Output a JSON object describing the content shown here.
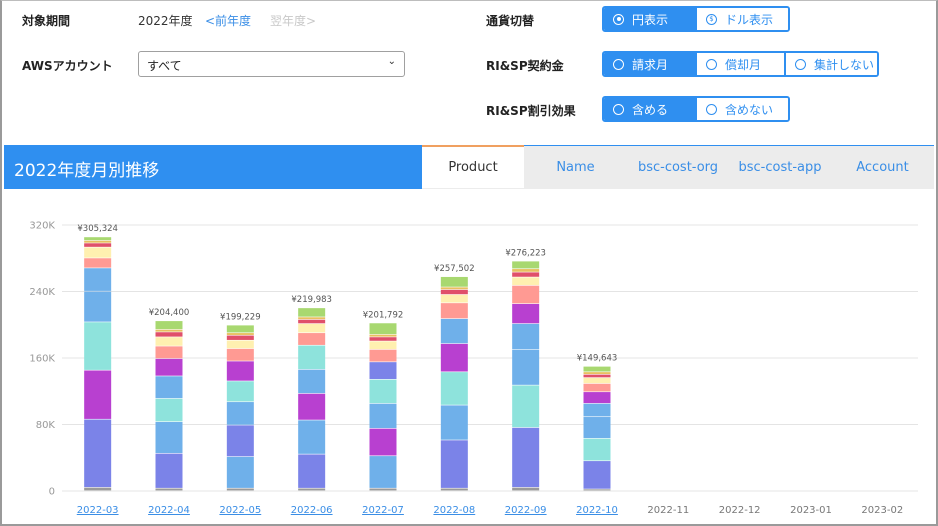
{
  "filters": {
    "period_label": "対象期間",
    "period_value": "2022年度",
    "prev_year": "<前年度",
    "next_year": "翌年度>",
    "account_label": "AWSアカウント",
    "account_value": "すべて",
    "currency_label": "通貨切替",
    "currency_options": [
      "円表示",
      "ドル表示"
    ],
    "currency_selected": "円表示",
    "risp_contract_label": "RI&SP契約金",
    "risp_contract_options": [
      "請求月",
      "償却月",
      "集計しない"
    ],
    "risp_contract_selected": "請求月",
    "risp_discount_label": "RI&SP割引効果",
    "risp_discount_options": [
      "含める",
      "含めない"
    ],
    "risp_discount_selected": "含める"
  },
  "panel": {
    "title": "2022年度月別推移",
    "tabs": [
      "Product",
      "Name",
      "bsc-cost-org",
      "bsc-cost-app",
      "Account"
    ],
    "active_tab": "Product"
  },
  "colors": {
    "accent": "#2f8ff0",
    "segments": [
      "#9a9a9a",
      "#7b83e8",
      "#6fb0ea",
      "#8ee3dc",
      "#b840d0",
      "#ff9a93",
      "#fff0b0",
      "#e0506a",
      "#e8c060",
      "#a8d870"
    ]
  },
  "chart_data": {
    "type": "bar",
    "stacked": true,
    "title": "",
    "xlabel": "",
    "ylabel": "",
    "ylim": [
      0,
      320000
    ],
    "yticks": [
      0,
      80000,
      160000,
      240000,
      320000
    ],
    "ytick_labels": [
      "0",
      "80K",
      "160K",
      "240K",
      "320K"
    ],
    "grid": true,
    "categories": [
      "2022-03",
      "2022-04",
      "2022-05",
      "2022-06",
      "2022-07",
      "2022-08",
      "2022-09",
      "2022-10",
      "2022-11",
      "2022-12",
      "2023-01",
      "2023-02"
    ],
    "linked_categories": [
      "2022-03",
      "2022-04",
      "2022-05",
      "2022-06",
      "2022-07",
      "2022-08",
      "2022-09",
      "2022-10"
    ],
    "totals": [
      305324,
      204400,
      199229,
      219983,
      201792,
      257502,
      276223,
      149643,
      null,
      null,
      null,
      null
    ],
    "total_labels": [
      "¥305,324",
      "¥204,400",
      "¥199,229",
      "¥219,983",
      "¥201,792",
      "¥257,502",
      "¥276,223",
      "¥149,643",
      "",
      "",
      "",
      ""
    ],
    "bars": [
      [
        [
          "#9a9a9a",
          4000
        ],
        [
          "#7b83e8",
          82000
        ],
        [
          "#b840d0",
          59000
        ],
        [
          "#8ee3dc",
          58000
        ],
        [
          "#6fb0ea",
          37000
        ],
        [
          "#6fb0ea",
          28000
        ],
        [
          "#ff9a93",
          12000
        ],
        [
          "#fff0b0",
          13000
        ],
        [
          "#e0506a",
          5000
        ],
        [
          "#e8c060",
          3000
        ],
        [
          "#a8d870",
          4324
        ]
      ],
      [
        [
          "#9a9a9a",
          3000
        ],
        [
          "#7b83e8",
          42000
        ],
        [
          "#6fb0ea",
          38000
        ],
        [
          "#8ee3dc",
          28000
        ],
        [
          "#6fb0ea",
          27000
        ],
        [
          "#b840d0",
          21000
        ],
        [
          "#ff9a93",
          15000
        ],
        [
          "#fff0b0",
          11000
        ],
        [
          "#e0506a",
          6000
        ],
        [
          "#e8c060",
          3000
        ],
        [
          "#a8d870",
          10400
        ]
      ],
      [
        [
          "#9a9a9a",
          3000
        ],
        [
          "#6fb0ea",
          38000
        ],
        [
          "#7b83e8",
          38000
        ],
        [
          "#6fb0ea",
          28000
        ],
        [
          "#8ee3dc",
          25000
        ],
        [
          "#b840d0",
          24000
        ],
        [
          "#ff9a93",
          15000
        ],
        [
          "#fff0b0",
          10000
        ],
        [
          "#e0506a",
          6000
        ],
        [
          "#e8c060",
          3000
        ],
        [
          "#a8d870",
          9229
        ]
      ],
      [
        [
          "#9a9a9a",
          3000
        ],
        [
          "#7b83e8",
          41000
        ],
        [
          "#6fb0ea",
          41000
        ],
        [
          "#b840d0",
          32000
        ],
        [
          "#6fb0ea",
          29000
        ],
        [
          "#8ee3dc",
          29000
        ],
        [
          "#ff9a93",
          15000
        ],
        [
          "#fff0b0",
          11000
        ],
        [
          "#e0506a",
          5000
        ],
        [
          "#e8c060",
          3000
        ],
        [
          "#a8d870",
          10983
        ]
      ],
      [
        [
          "#9a9a9a",
          3000
        ],
        [
          "#6fb0ea",
          39000
        ],
        [
          "#b840d0",
          33000
        ],
        [
          "#6fb0ea",
          30000
        ],
        [
          "#8ee3dc",
          29000
        ],
        [
          "#7b83e8",
          21000
        ],
        [
          "#ff9a93",
          15000
        ],
        [
          "#fff0b0",
          10000
        ],
        [
          "#e0506a",
          5000
        ],
        [
          "#e8c060",
          3000
        ],
        [
          "#a8d870",
          13792
        ]
      ],
      [
        [
          "#9a9a9a",
          3000
        ],
        [
          "#7b83e8",
          58000
        ],
        [
          "#6fb0ea",
          42000
        ],
        [
          "#8ee3dc",
          40000
        ],
        [
          "#b840d0",
          34000
        ],
        [
          "#6fb0ea",
          30000
        ],
        [
          "#ff9a93",
          19000
        ],
        [
          "#fff0b0",
          10000
        ],
        [
          "#e0506a",
          6000
        ],
        [
          "#e8c060",
          3000
        ],
        [
          "#a8d870",
          12502
        ]
      ],
      [
        [
          "#9a9a9a",
          4000
        ],
        [
          "#7b83e8",
          72000
        ],
        [
          "#8ee3dc",
          51000
        ],
        [
          "#6fb0ea",
          43000
        ],
        [
          "#6fb0ea",
          31000
        ],
        [
          "#b840d0",
          24000
        ],
        [
          "#ff9a93",
          22000
        ],
        [
          "#fff0b0",
          10000
        ],
        [
          "#e0506a",
          6000
        ],
        [
          "#e8c060",
          4000
        ],
        [
          "#a8d870",
          9223
        ]
      ],
      [
        [
          "#9a9a9a",
          2000
        ],
        [
          "#7b83e8",
          34000
        ],
        [
          "#8ee3dc",
          27000
        ],
        [
          "#6fb0ea",
          26000
        ],
        [
          "#6fb0ea",
          16000
        ],
        [
          "#b840d0",
          14000
        ],
        [
          "#ff9a93",
          10000
        ],
        [
          "#fff0b0",
          7000
        ],
        [
          "#e0506a",
          4000
        ],
        [
          "#e8c060",
          3000
        ],
        [
          "#a8d870",
          6643
        ]
      ],
      [],
      [],
      [],
      []
    ]
  }
}
